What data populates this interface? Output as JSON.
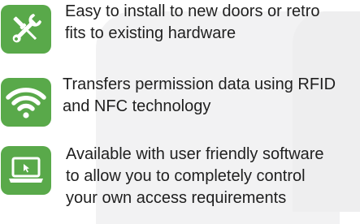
{
  "features": [
    {
      "icon": "wrench-screwdriver-icon",
      "lines": [
        "Easy to install to new doors or retro",
        "fits to existing hardware"
      ]
    },
    {
      "icon": "wifi-icon",
      "lines": [
        "Transfers permission data using RFID",
        "and NFC technology"
      ]
    },
    {
      "icon": "laptop-icon",
      "lines": [
        "Available with user friendly software",
        "to allow you to completely control",
        "your own access requirements"
      ]
    }
  ],
  "colors": {
    "icon_background": "#59a94a",
    "icon_foreground": "#ffffff",
    "text": "#1f1f1f",
    "background_shape": "#f2f2f3"
  }
}
